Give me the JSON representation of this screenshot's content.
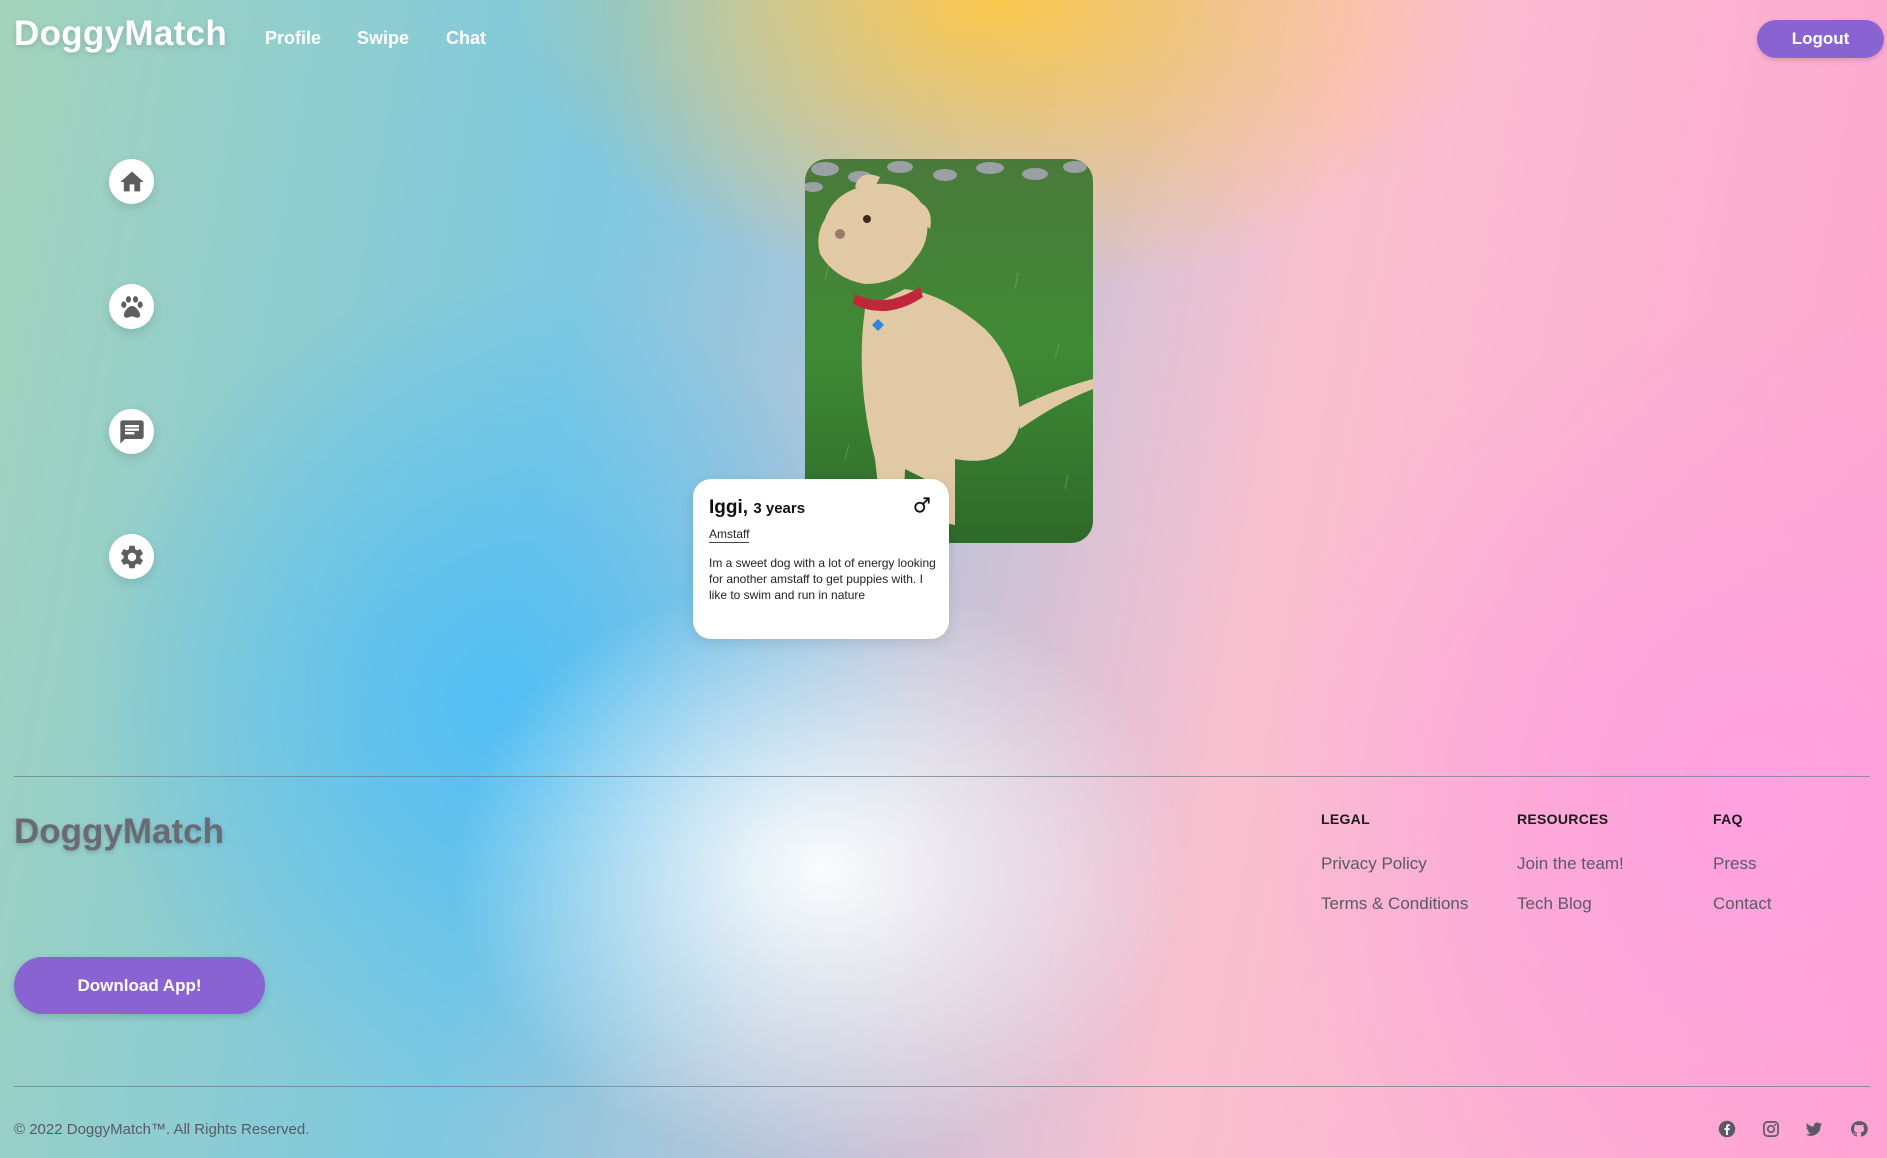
{
  "app": {
    "brand": "DoggyMatch",
    "accent_color": "#8a63d2"
  },
  "header": {
    "nav": [
      "Profile",
      "Swipe",
      "Chat"
    ],
    "logout_label": "Logout"
  },
  "sidebar": {
    "items": [
      {
        "icon": "home-icon"
      },
      {
        "icon": "paw-icon"
      },
      {
        "icon": "chat-icon"
      },
      {
        "icon": "gear-icon"
      }
    ]
  },
  "profile_card": {
    "name": "Iggi,",
    "age": "3 years",
    "gender_icon": "male-icon",
    "breed": "Amstaff",
    "bio": "Im a sweet dog with a lot of energy looking for another amstaff to get puppies with. I like to swim and run in nature"
  },
  "footer": {
    "brand": "DoggyMatch",
    "download_label": "Download App!",
    "columns": [
      {
        "title": "LEGAL",
        "links": [
          "Privacy Policy",
          "Terms & Conditions"
        ]
      },
      {
        "title": "RESOURCES",
        "links": [
          "Join the team!",
          "Tech Blog"
        ]
      },
      {
        "title": "FAQ",
        "links": [
          "Press",
          "Contact"
        ]
      }
    ],
    "copyright": "© 2022 DoggyMatch™. All Rights Reserved.",
    "social": [
      "facebook-icon",
      "instagram-icon",
      "twitter-icon",
      "github-icon"
    ]
  }
}
